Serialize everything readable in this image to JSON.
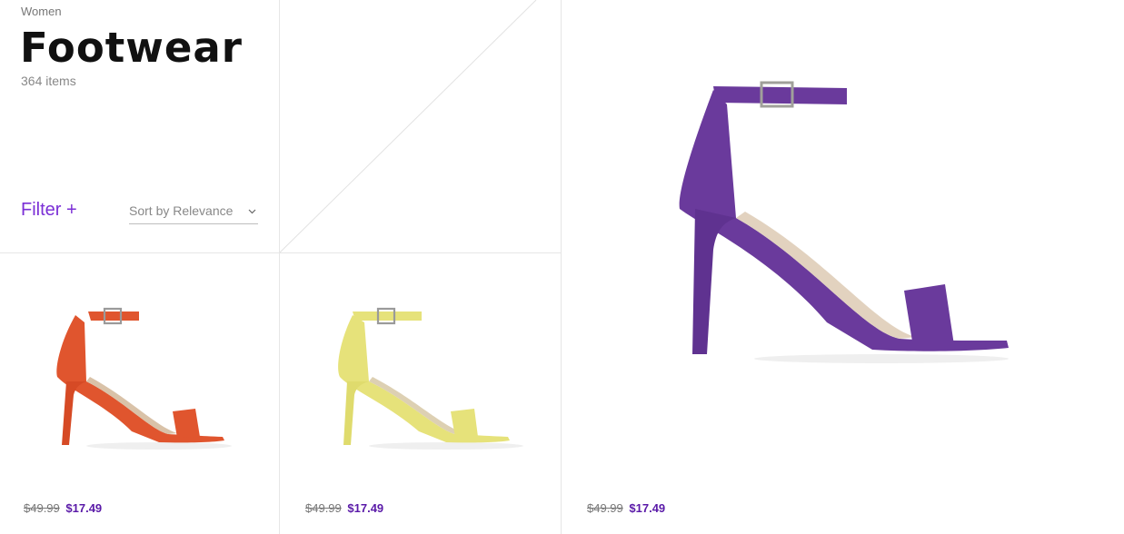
{
  "header": {
    "breadcrumb": "Women",
    "title": "Footwear",
    "item_count": "364 items",
    "filter_label": "Filter +",
    "sort_label": "Sort by Relevance",
    "sort_icon": "chevron-down-icon"
  },
  "products": [
    {
      "name": "orange-ankle-strap-sandal",
      "color": "#e0552e",
      "old_price": "$49.99",
      "new_price": "$17.49"
    },
    {
      "name": "yellow-ankle-strap-sandal",
      "color": "#e6e27a",
      "old_price": "$49.99",
      "new_price": "$17.49"
    },
    {
      "name": "purple-ankle-strap-sandal",
      "color": "#6a3a9c",
      "old_price": "$49.99",
      "new_price": "$17.49"
    }
  ],
  "colors": {
    "accent": "#7b2fd6",
    "sale_price": "#5a1aa8",
    "grid_line": "#e6e6e6"
  }
}
